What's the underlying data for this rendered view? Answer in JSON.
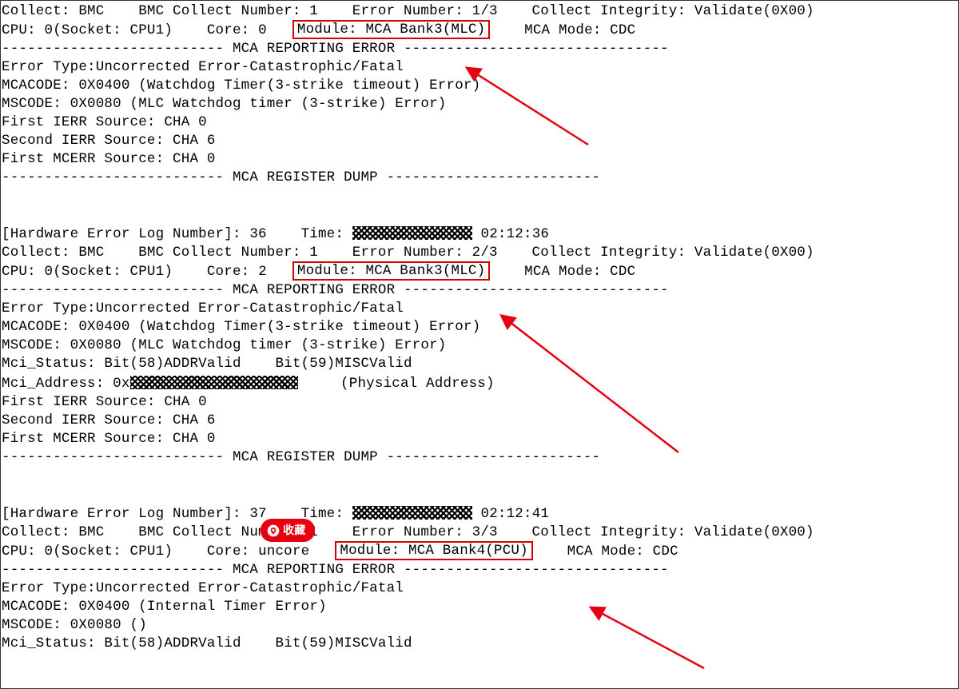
{
  "entry1": {
    "l1_a": "Collect: BMC",
    "l1_b": "BMC Collect Number: 1",
    "l1_c": "Error Number: 1/3",
    "l1_d": "Collect Integrity: Validate(0X00)",
    "l2_a": "CPU: 0(Socket: CPU1)",
    "l2_b": "Core: 0",
    "module_label": "Module: MCA Bank3(MLC)",
    "l2_d": "MCA Mode: CDC",
    "sep_report": "-------------------------- MCA REPORTING ERROR -------------------------------",
    "etype": "Error Type:Uncorrected Error-Catastrophic/Fatal",
    "mcacode": "MCACODE: 0X0400 (Watchdog Timer(3-strike timeout) Error)",
    "mscode": "MSCODE: 0X0080 (MLC Watchdog timer (3-strike) Error)",
    "ierr1": "First IERR Source: CHA 0",
    "ierr2": "Second IERR Source: CHA 6",
    "mcerr1": "First MCERR Source: CHA 0",
    "sep_dump": "-------------------------- MCA REGISTER DUMP -------------------------"
  },
  "entry2": {
    "hdr_a": "[Hardware Error Log Number]: 36",
    "hdr_b": "Time: ",
    "hdr_c": " 02:12:36",
    "l1_a": "Collect: BMC",
    "l1_b": "BMC Collect Number: 1",
    "l1_c": "Error Number: 2/3",
    "l1_d": "Collect Integrity: Validate(0X00)",
    "l2_a": "CPU: 0(Socket: CPU1)",
    "l2_b": "Core: 2",
    "module_label": "Module: MCA Bank3(MLC)",
    "l2_d": "MCA Mode: CDC",
    "sep_report": "-------------------------- MCA REPORTING ERROR -------------------------------",
    "etype": "Error Type:Uncorrected Error-Catastrophic/Fatal",
    "mcacode": "MCACODE: 0X0400 (Watchdog Timer(3-strike timeout) Error)",
    "mscode": "MSCODE: 0X0080 (MLC Watchdog timer (3-strike) Error)",
    "mcistatus": "Mci_Status: Bit(58)ADDRValid    Bit(59)MISCValid",
    "mciaddr_a": "Mci_Address: 0x",
    "mciaddr_b": "     (Physical Address)",
    "ierr1": "First IERR Source: CHA 0",
    "ierr2": "Second IERR Source: CHA 6",
    "mcerr1": "First MCERR Source: CHA 0",
    "sep_dump": "-------------------------- MCA REGISTER DUMP -------------------------"
  },
  "entry3": {
    "hdr_a": "[Hardware Error Log Number]: 37",
    "hdr_b": "Time: ",
    "hdr_c": " 02:12:41",
    "l1_a": "Collect: BMC",
    "l1_b": "BMC Collect Number: 1",
    "l1_c": "Error Number: 3/3",
    "l1_d": "Collect Integrity: Validate(0X00)",
    "l2_a": "CPU: 0(Socket: CPU1)",
    "l2_b": "Core: uncore",
    "module_label": "Module: MCA Bank4(PCU)",
    "l2_d": "MCA Mode: CDC",
    "sep_report": "-------------------------- MCA REPORTING ERROR -------------------------------",
    "etype": "Error Type:Uncorrected Error-Catastrophic/Fatal",
    "mcacode": "MCACODE: 0X0400 (Internal Timer Error)",
    "mscode": "MSCODE: 0X0080 ()",
    "mcistatus": "Mci_Status: Bit(58)ADDRValid    Bit(59)MISCValid"
  },
  "ui": {
    "bookmark_label": "收藏"
  }
}
